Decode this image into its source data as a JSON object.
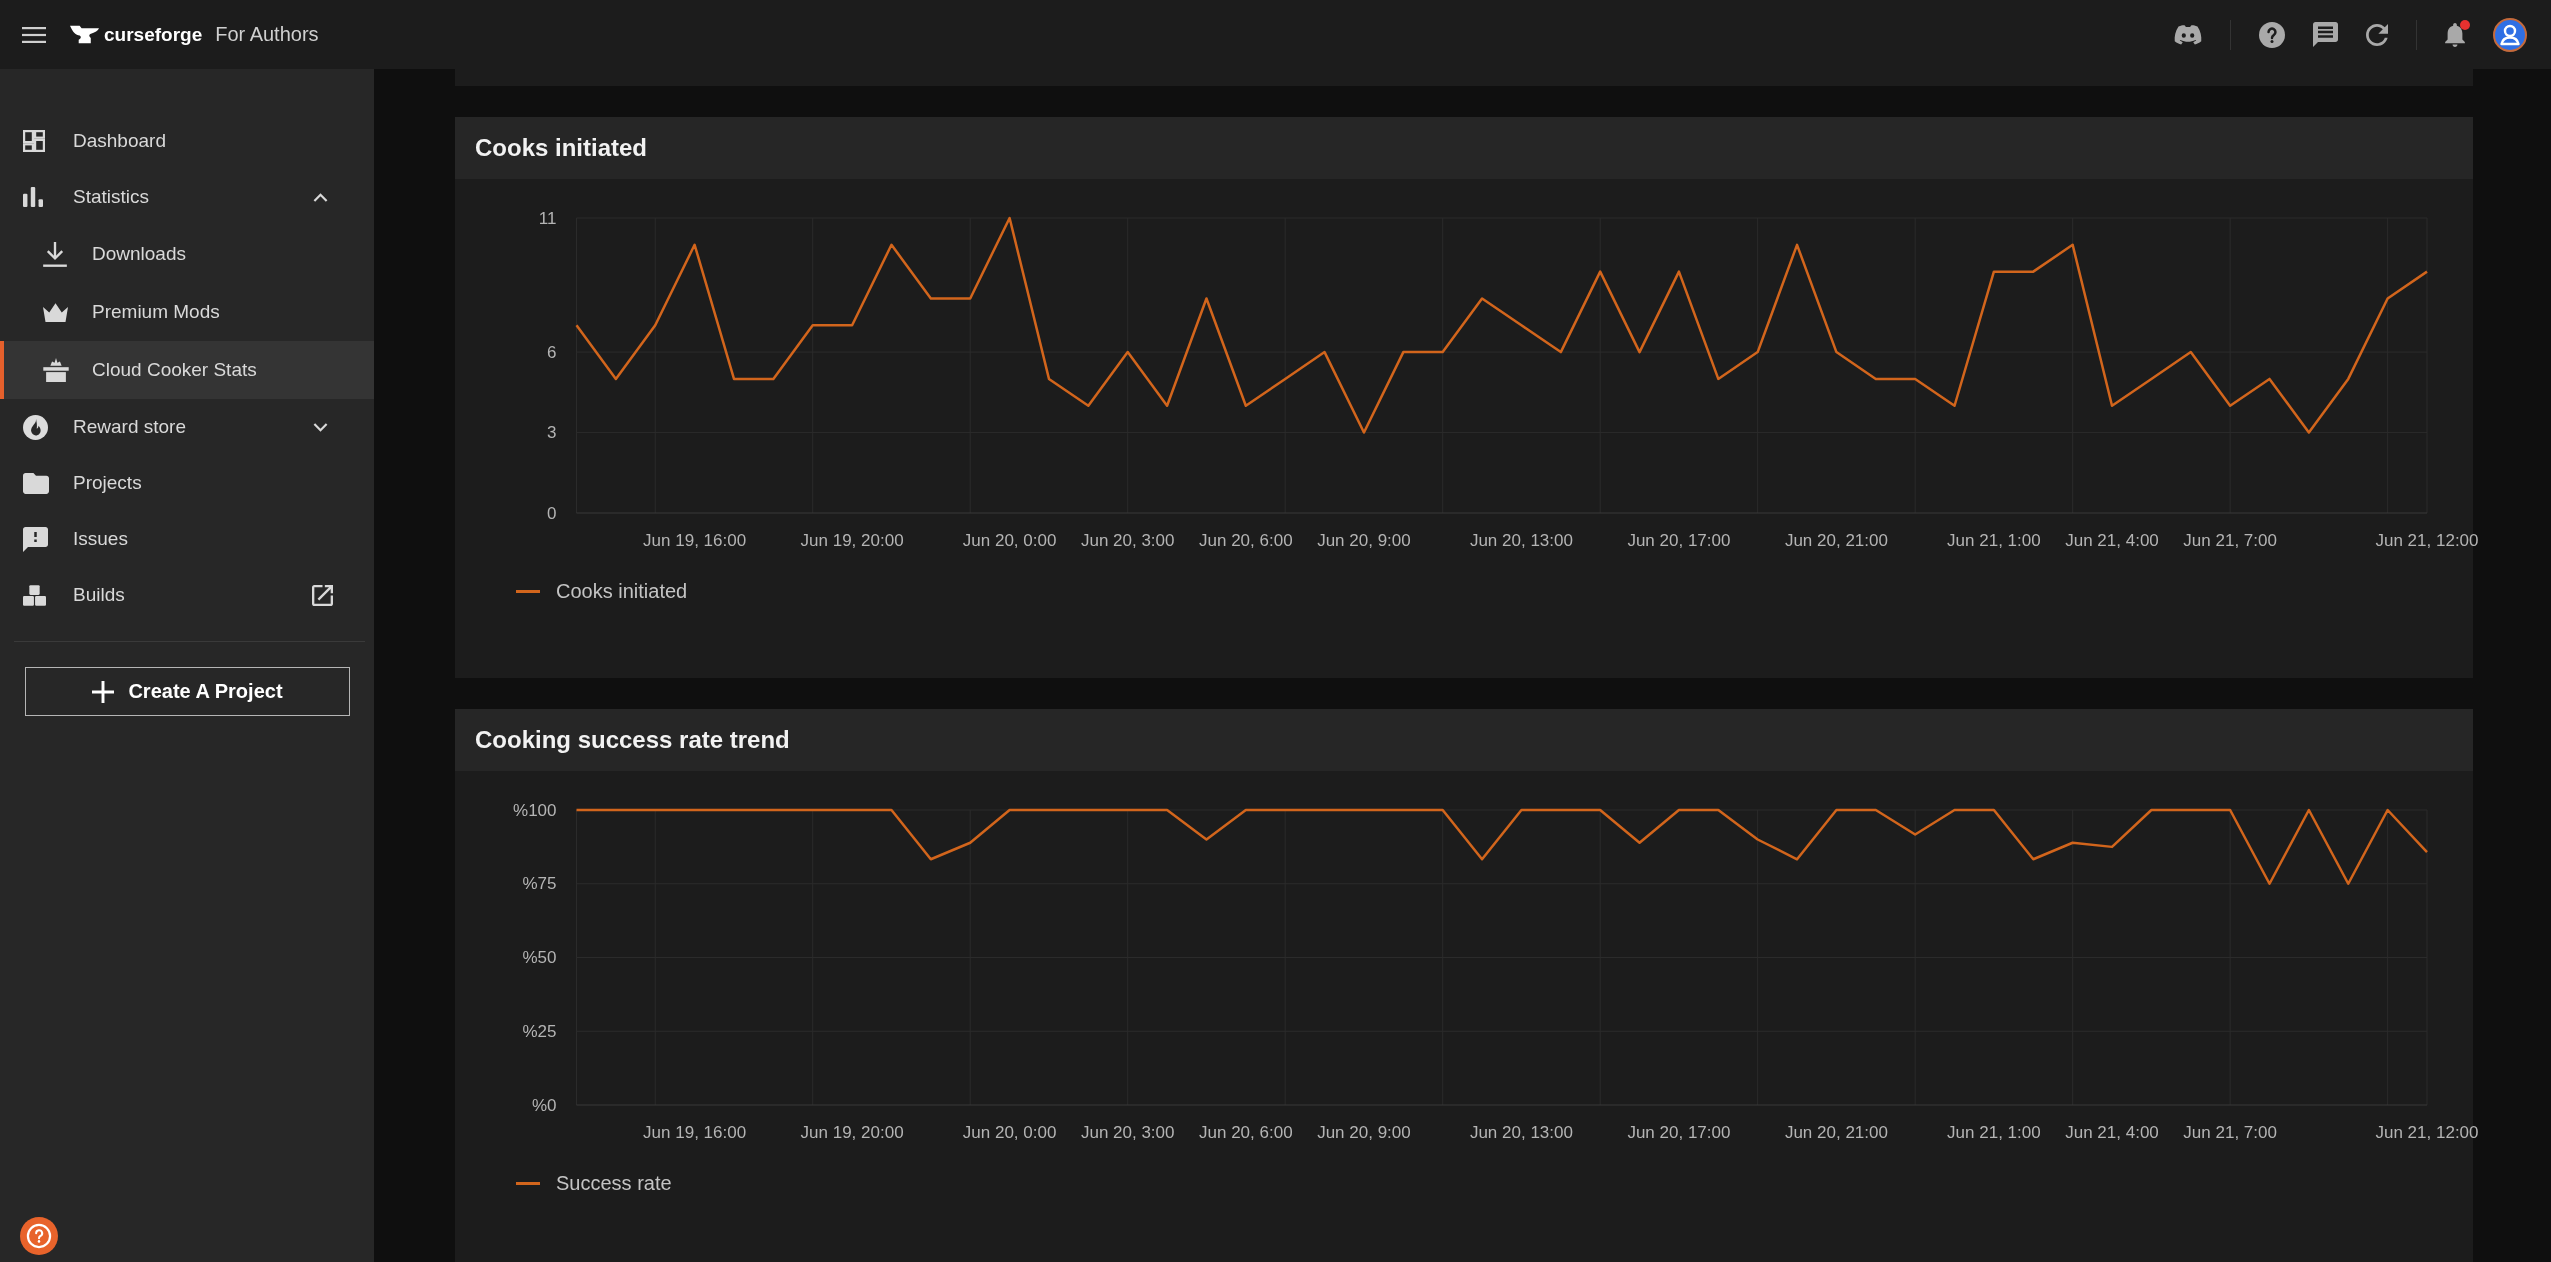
{
  "topbar": {
    "brand": "curseforge",
    "section": "For Authors",
    "notifications_unread": true
  },
  "sidebar": {
    "items": [
      {
        "label": "Dashboard",
        "kind": "link",
        "selected": false
      },
      {
        "label": "Statistics",
        "kind": "group",
        "selected": false,
        "expanded": true,
        "children": [
          {
            "label": "Downloads",
            "selected": false
          },
          {
            "label": "Premium Mods",
            "selected": false
          },
          {
            "label": "Cloud Cooker Stats",
            "selected": true
          }
        ]
      },
      {
        "label": "Reward store",
        "kind": "group",
        "selected": false,
        "expanded": false
      },
      {
        "label": "Projects",
        "kind": "link",
        "selected": false
      },
      {
        "label": "Issues",
        "kind": "link",
        "selected": false
      },
      {
        "label": "Builds",
        "kind": "external",
        "selected": false
      }
    ],
    "create_button": "Create A Project"
  },
  "cards": [
    {
      "title": "Cooks initiated",
      "chart_data": {
        "type": "line",
        "grid": true,
        "categories": [
          null,
          null,
          null,
          "Jun 19, 16:00",
          null,
          null,
          null,
          "Jun 19, 20:00",
          null,
          null,
          null,
          "Jun 20, 0:00",
          null,
          null,
          "Jun 20, 3:00",
          null,
          null,
          "Jun 20, 6:00",
          null,
          null,
          "Jun 20, 9:00",
          null,
          null,
          null,
          "Jun 20, 13:00",
          null,
          null,
          null,
          "Jun 20, 17:00",
          null,
          null,
          null,
          "Jun 20, 21:00",
          null,
          null,
          null,
          "Jun 21, 1:00",
          null,
          null,
          "Jun 21, 4:00",
          null,
          null,
          "Jun 21, 7:00",
          null,
          null,
          null,
          null,
          "Jun 21, 12:00"
        ],
        "ylim": [
          0,
          11
        ],
        "yticks": [
          0,
          3,
          6,
          11
        ],
        "series": [
          {
            "name": "Cooks initiated",
            "color": "#d2651c",
            "values": [
              7,
              5,
              7,
              10,
              5,
              5,
              7,
              7,
              10,
              8,
              8,
              11,
              5,
              4,
              6,
              4,
              8,
              4,
              5,
              6,
              3,
              6,
              6,
              8,
              7,
              6,
              9,
              6,
              9,
              5,
              6,
              10,
              6,
              5,
              5,
              4,
              9,
              9,
              10,
              4,
              5,
              6,
              4,
              5,
              3,
              5,
              8,
              9
            ]
          }
        ]
      }
    },
    {
      "title": "Cooking success rate trend",
      "chart_data": {
        "type": "line",
        "grid": true,
        "categories": [
          null,
          null,
          null,
          "Jun 19, 16:00",
          null,
          null,
          null,
          "Jun 19, 20:00",
          null,
          null,
          null,
          "Jun 20, 0:00",
          null,
          null,
          "Jun 20, 3:00",
          null,
          null,
          "Jun 20, 6:00",
          null,
          null,
          "Jun 20, 9:00",
          null,
          null,
          null,
          "Jun 20, 13:00",
          null,
          null,
          null,
          "Jun 20, 17:00",
          null,
          null,
          null,
          "Jun 20, 21:00",
          null,
          null,
          null,
          "Jun 21, 1:00",
          null,
          null,
          "Jun 21, 4:00",
          null,
          null,
          "Jun 21, 7:00",
          null,
          null,
          null,
          null,
          "Jun 21, 12:00"
        ],
        "ylim": [
          0,
          100
        ],
        "yticks": [
          {
            "value": 0,
            "label": "%0"
          },
          {
            "value": 25,
            "label": "%25"
          },
          {
            "value": 50,
            "label": "%50"
          },
          {
            "value": 75,
            "label": "%75"
          },
          {
            "value": 100,
            "label": "%100"
          }
        ],
        "series": [
          {
            "name": "Success rate",
            "color": "#d2651c",
            "values": [
              100,
              100,
              100,
              100,
              100,
              100,
              100,
              100,
              100,
              83.3,
              88.9,
              100,
              100,
              100,
              100,
              100,
              90,
              100,
              100,
              100,
              100,
              100,
              100,
              83.3,
              100,
              100,
              100,
              88.9,
              100,
              100,
              90,
              83.3,
              100,
              100,
              91.7,
              100,
              100,
              83.3,
              88.9,
              87.5,
              100,
              100,
              100,
              75,
              100,
              75,
              100,
              85.7
            ]
          }
        ]
      }
    }
  ]
}
